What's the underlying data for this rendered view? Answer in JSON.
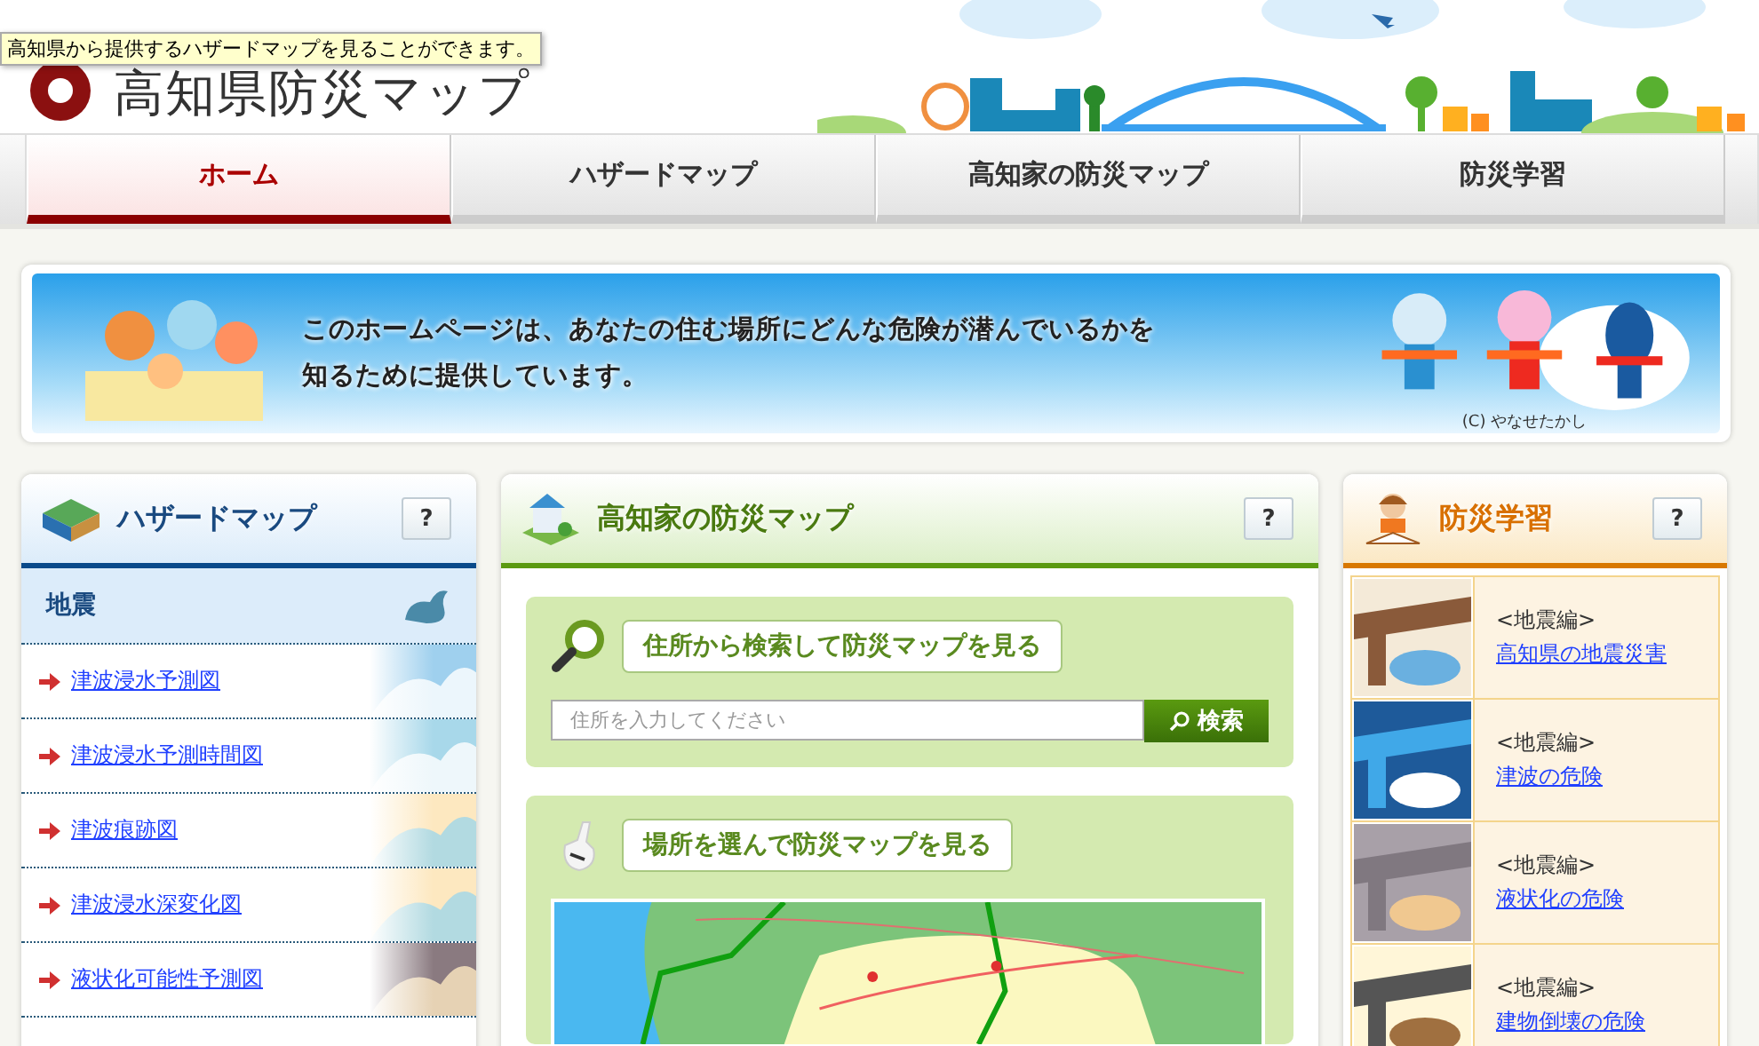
{
  "header": {
    "logo_title": "高知県防災マップ",
    "tooltip": "高知県から提供するハザードマップを見ることができます。"
  },
  "nav": [
    {
      "label": "ホーム",
      "selected": true
    },
    {
      "label": "ハザードマップ",
      "selected": false
    },
    {
      "label": "高知家の防災マップ",
      "selected": false
    },
    {
      "label": "防災学習",
      "selected": false
    }
  ],
  "banner": {
    "lines": [
      "このホームページは、あなたの住む場所にどんな危険が潜んでいるかを",
      "知るために提供しています。"
    ],
    "credit": "(C) やなせたかし"
  },
  "hazard_panel": {
    "title": "ハザードマップ",
    "help": "?",
    "category": "地震",
    "links": [
      "津波浸水予測図",
      "津波浸水予測時間図",
      "津波痕跡図",
      "津波浸水深変化図",
      "液状化可能性予測図"
    ]
  },
  "home_map_panel": {
    "title": "高知家の防災マップ",
    "help": "?",
    "search_heading": "住所から検索して防災マップを見る",
    "search": {
      "placeholder": "住所を入力してください"
    },
    "search_button": "検索",
    "select_heading": "場所を選んで防災マップを見る"
  },
  "learning_panel": {
    "title": "防災学習",
    "help": "?",
    "items": [
      {
        "category": "<地震編>",
        "link": "高知県の地震災害"
      },
      {
        "category": "<地震編>",
        "link": "津波の危険"
      },
      {
        "category": "<地震編>",
        "link": "液状化の危険"
      },
      {
        "category": "<地震編>",
        "link": "建物倒壊の危険"
      }
    ]
  }
}
